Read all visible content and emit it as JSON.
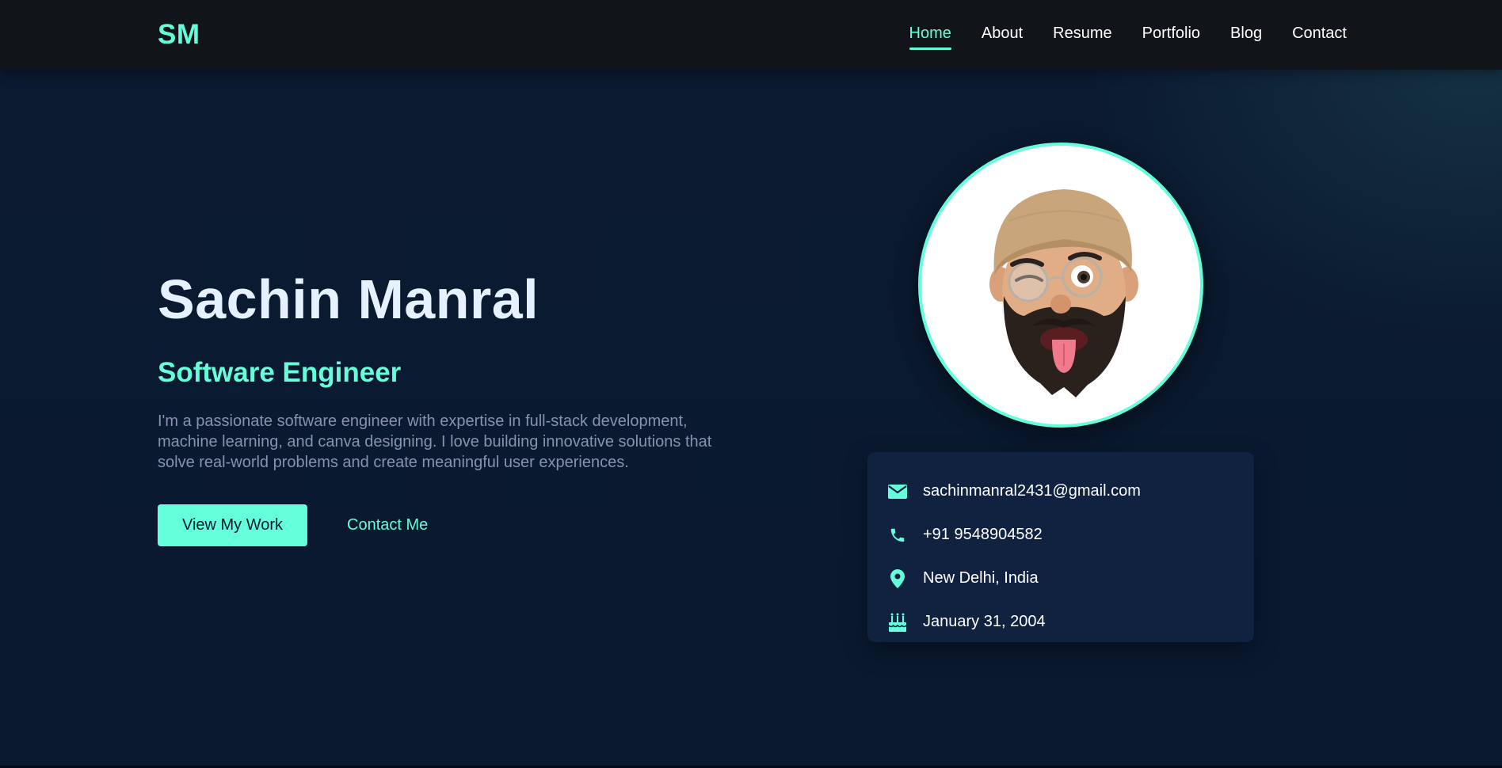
{
  "nav": {
    "logo": "SM",
    "links": [
      {
        "label": "Home",
        "active": true
      },
      {
        "label": "About",
        "active": false
      },
      {
        "label": "Resume",
        "active": false
      },
      {
        "label": "Portfolio",
        "active": false
      },
      {
        "label": "Blog",
        "active": false
      },
      {
        "label": "Contact",
        "active": false
      }
    ]
  },
  "hero": {
    "name": "Sachin Manral",
    "role": "Software Engineer",
    "bio": "I'm a passionate software engineer with expertise in full-stack development, machine learning, and canva designing. I love building innovative solutions that solve real-world problems and create meaningful user experiences.",
    "primary_button": "View My Work",
    "secondary_button": "Contact Me"
  },
  "contact": {
    "email": "sachinmanral2431@gmail.com",
    "phone": "+91 9548904582",
    "location": "New Delhi, India",
    "birthday": "January 31, 2004"
  },
  "icons": {
    "email": "envelope-icon",
    "phone": "phone-icon",
    "location": "map-pin-icon",
    "birthday": "birthday-cake-icon"
  },
  "colors": {
    "accent": "#64ffda",
    "background": "#0a192f",
    "card": "#112240",
    "nav": "#111418",
    "heading": "#e6f1ff",
    "muted": "#8892b0"
  }
}
